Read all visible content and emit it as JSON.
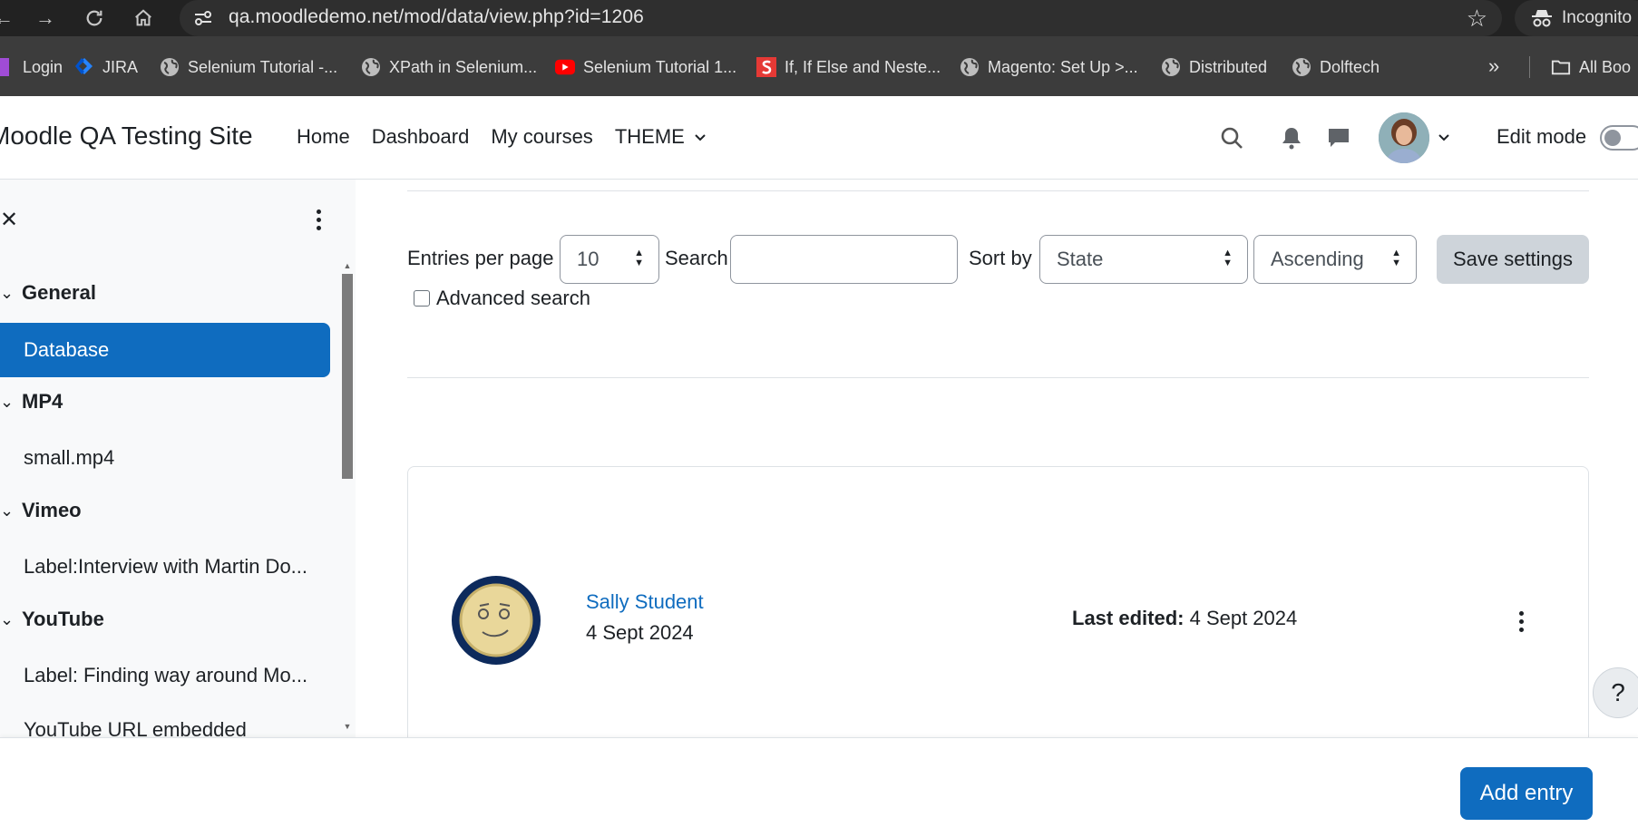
{
  "browser": {
    "url": "qa.moodledemo.net/mod/data/view.php?id=1206",
    "incognito_label": "Incognito",
    "bookmarks": [
      "Login",
      "JIRA",
      "Selenium Tutorial -...",
      "XPath in Selenium...",
      "Selenium Tutorial 1...",
      "If, If Else and Neste...",
      "Magento: Set Up >...",
      "Distributed",
      "Dolftech"
    ],
    "all_bookmarks_label": "All Boo"
  },
  "navbar": {
    "site_name": "Moodle QA Testing Site",
    "items": [
      "Home",
      "Dashboard",
      "My courses",
      "THEME"
    ],
    "edit_mode_label": "Edit mode"
  },
  "course_index": {
    "sections": [
      {
        "title": "General",
        "items": [
          "Database"
        ]
      },
      {
        "title": "MP4",
        "items": [
          "small.mp4"
        ]
      },
      {
        "title": "Vimeo",
        "items": [
          "Label:Interview with Martin Do..."
        ]
      },
      {
        "title": "YouTube",
        "items": [
          "Label: Finding way around Mo...",
          "YouTube URL embedded"
        ]
      }
    ],
    "active_item": "Database"
  },
  "search_form": {
    "entries_per_page_label": "Entries per page",
    "entries_per_page_value": "10",
    "search_label": "Search",
    "search_value": "",
    "sort_by_label": "Sort by",
    "sort_field_value": "State",
    "sort_order_value": "Ascending",
    "save_settings_label": "Save settings",
    "advanced_search_label": "Advanced search"
  },
  "entry": {
    "author": "Sally Student",
    "date": "4 Sept 2024",
    "last_edited_label": "Last edited:",
    "last_edited_value": "4 Sept 2024"
  },
  "help_label": "?",
  "add_entry_label": "Add entry",
  "colors": {
    "primary": "#0f6cbf",
    "drawer_bg": "#f8f9fa",
    "secondary_btn": "#ced4da"
  }
}
